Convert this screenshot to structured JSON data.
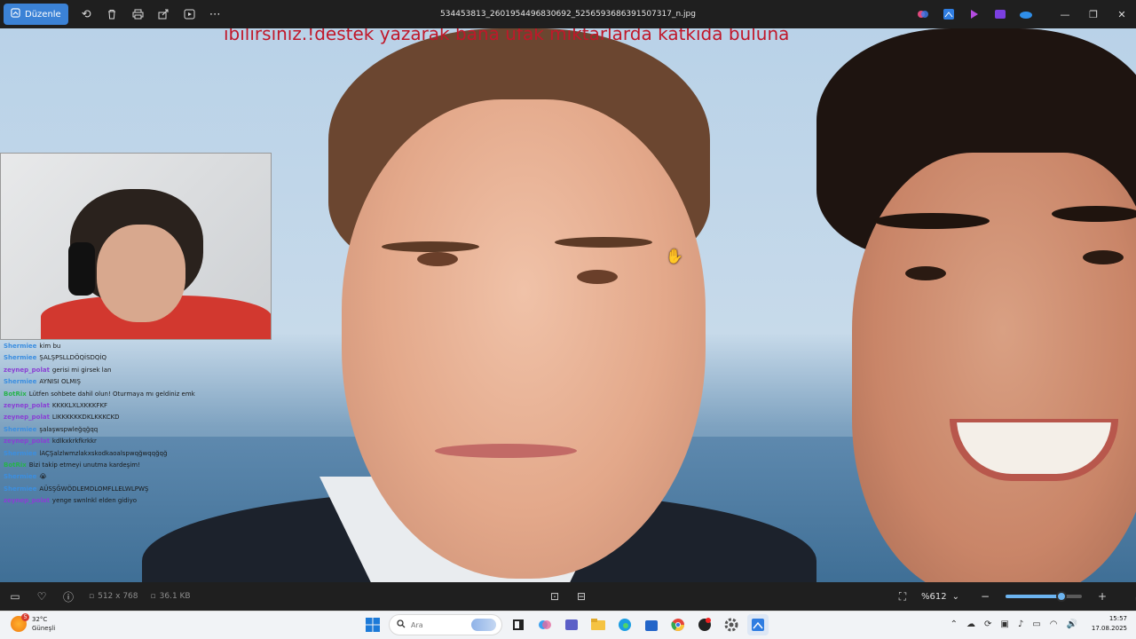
{
  "titlebar": {
    "edit_label": "Düzenle",
    "filename": "534453813_2601954496830692_5256593686391507317_n.jpg",
    "icons": [
      "rotate-icon",
      "delete-icon",
      "print-icon",
      "share-icon",
      "slideshow-icon",
      "more-icon"
    ]
  },
  "overlay": {
    "donation_text": "ıbilirsiniz.!destek yazarak bana ufak miktarlarda katkıda bulunа"
  },
  "chat": {
    "messages": [
      {
        "user": "Shermiee",
        "text": "kim bu",
        "color": "#3b8ee0"
      },
      {
        "user": "Shermiee",
        "text": "ŞALŞPSLLDÖQİSDQİQ",
        "color": "#3b8ee0"
      },
      {
        "user": "zeynep_polat",
        "text": "gerisi mi girsek lan",
        "color": "#8a3fd4"
      },
      {
        "user": "Shermiee",
        "text": "AYNISI OLMIŞ",
        "color": "#3b8ee0"
      },
      {
        "user": "BotRix",
        "text": "Lütfen sohbete dahil olun! Oturmaya mı geldiniz emk",
        "color": "#27b34b"
      },
      {
        "user": "zeynep_polat",
        "text": "KKKKLXLXKKKFKF",
        "color": "#8a3fd4"
      },
      {
        "user": "zeynep_polat",
        "text": "LIKKKKKKDKLKKKCKD",
        "color": "#8a3fd4"
      },
      {
        "user": "Shermiee",
        "text": "şalaşwspwleğqğqq",
        "color": "#3b8ee0"
      },
      {
        "user": "zeynep_polat",
        "text": "kdlkxkrkfkrkkr",
        "color": "#8a3fd4"
      },
      {
        "user": "Shermiee",
        "text": "lAÇŞalzlwmzlakxskodkaoalspwqğwqqğqğ",
        "color": "#3b8ee0"
      },
      {
        "user": "BotRix",
        "text": "Bizi takip etmeyi unutma kardeşim!",
        "color": "#27b34b"
      },
      {
        "user": "Shermiee",
        "text": "😭",
        "color": "#3b8ee0"
      },
      {
        "user": "Shermiee",
        "text": "AÜSŞĞWÖDLEMDLOMFLLELWLPWŞ",
        "color": "#3b8ee0"
      },
      {
        "user": "zeynep_polat",
        "text": "yenge swnlnkl elden gidiyo",
        "color": "#8a3fd4"
      }
    ]
  },
  "statusbar": {
    "dimensions": "512 x 768",
    "filesize": "36.1 KB",
    "zoom": "%612",
    "zoom_level": 0.73
  },
  "taskbar": {
    "temperature": "32°C",
    "weather": "Güneşli",
    "weather_badge": "5",
    "search_placeholder": "Ara",
    "time": "15:57",
    "date": "17.08.2025"
  }
}
